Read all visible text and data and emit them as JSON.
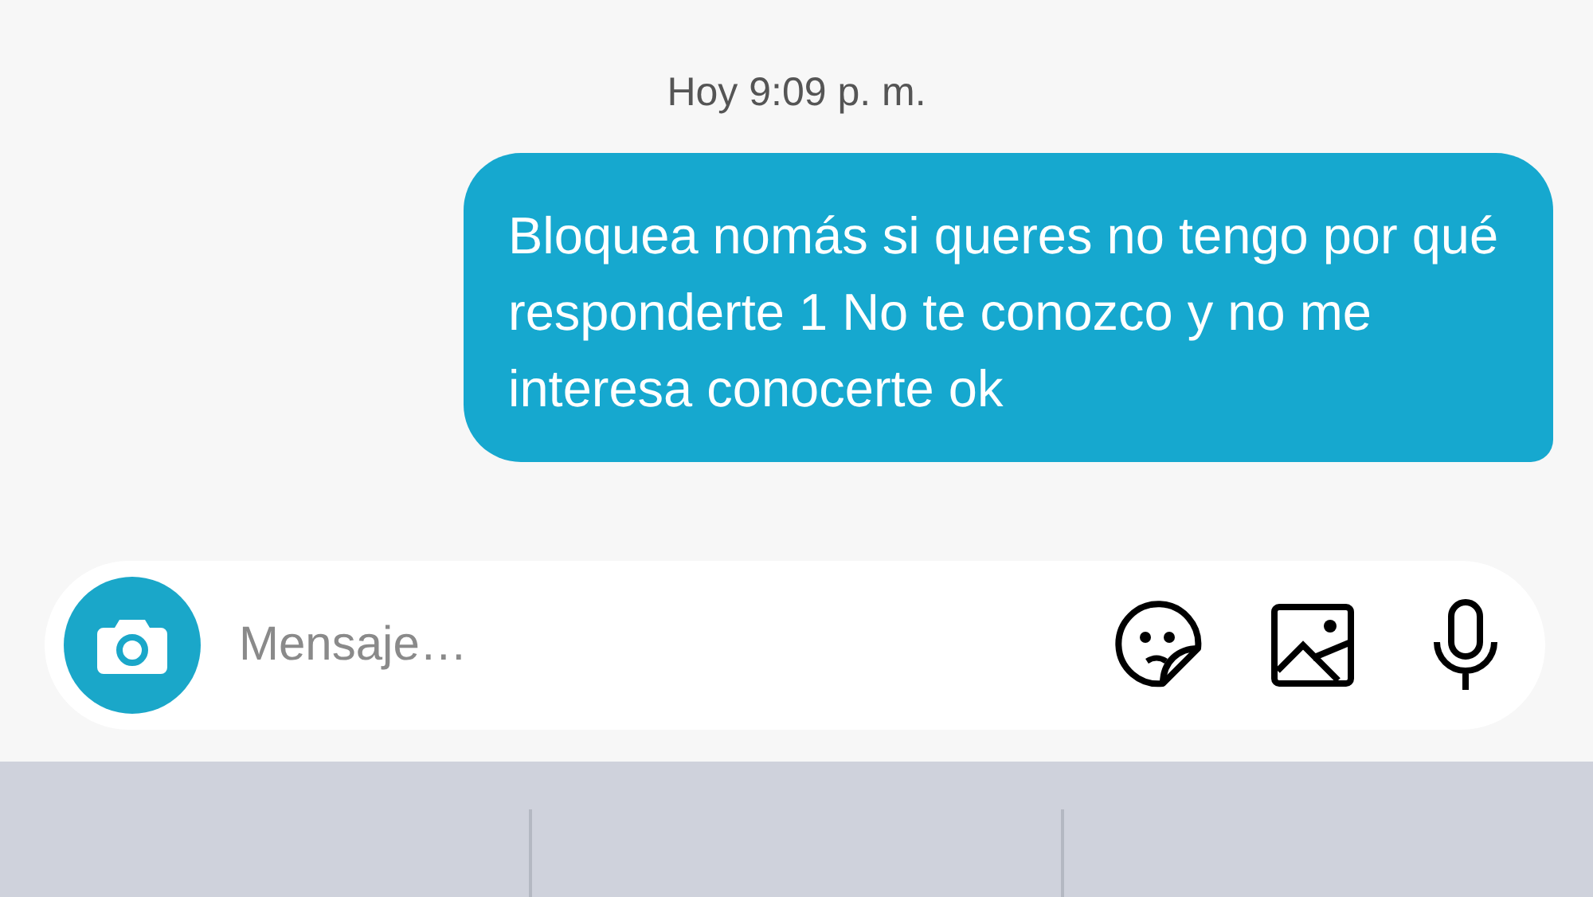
{
  "timestamp": "Hoy 9:09 p. m.",
  "messages": [
    {
      "text": "Bloquea nomás si queres no tengo por qué responderte 1 No te conozco y no me interesa conocerte ok",
      "kind": "sent"
    }
  ],
  "composer": {
    "placeholder": "Mensaje…"
  }
}
